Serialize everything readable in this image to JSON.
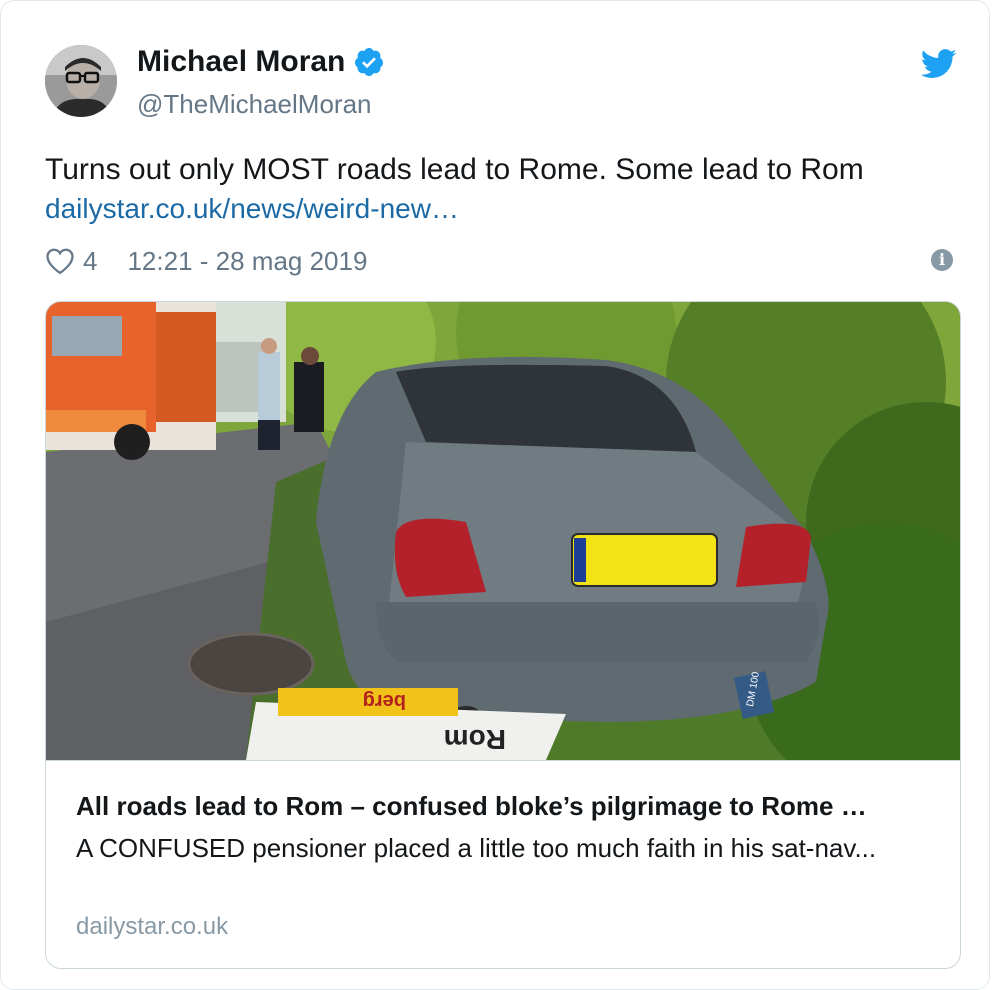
{
  "author": {
    "name": "Michael Moran",
    "handle": "@TheMichaelMoran",
    "verified": true
  },
  "tweet": {
    "text": "Turns out only MOST roads lead to Rome. Some lead to Rom",
    "link": "dailystar.co.uk/news/weird-new…",
    "likes": "4",
    "timestamp": "12:21 - 28 mag 2019"
  },
  "link_card": {
    "title": "All roads lead to Rom – confused bloke’s pilgrimage to Rome …",
    "description": "A CONFUSED pensioner placed a little too much faith in his sat-nav...",
    "domain": "dailystar.co.uk"
  },
  "photo": {
    "plate": "",
    "sign_rom": "Rom",
    "sign_berg": "berg",
    "post_tag": "DM 100"
  },
  "icons": {
    "brand": "twitter-bird-icon",
    "like": "heart-icon",
    "info": "info-icon",
    "verified": "verified-badge-icon"
  },
  "colors": {
    "link": "#1b6aa5",
    "twitter_blue": "#1da1f2",
    "muted": "#657786"
  }
}
